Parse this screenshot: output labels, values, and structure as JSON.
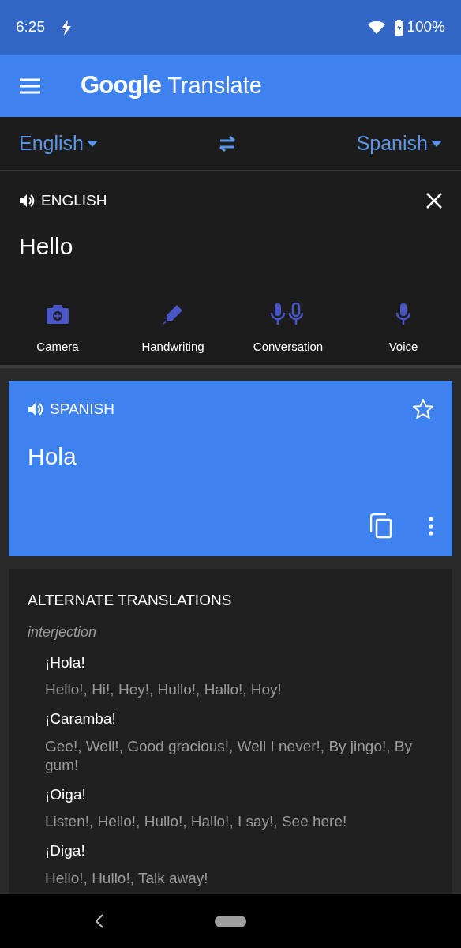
{
  "status_bar": {
    "time": "6:25",
    "battery": "100%"
  },
  "app_bar": {
    "title_brand": "Google",
    "title_product": "Translate"
  },
  "languages": {
    "source": "English",
    "target": "Spanish"
  },
  "input": {
    "language_label": "ENGLISH",
    "text": "Hello"
  },
  "tools": [
    {
      "kind": "camera",
      "label": "Camera"
    },
    {
      "kind": "handwriting",
      "label": "Handwriting"
    },
    {
      "kind": "conversation",
      "label": "Conversation"
    },
    {
      "kind": "voice",
      "label": "Voice"
    }
  ],
  "result": {
    "language_label": "SPANISH",
    "text": "Hola",
    "starred": false
  },
  "alternates": {
    "heading": "ALTERNATE TRANSLATIONS",
    "part_of_speech": "interjection",
    "entries": [
      {
        "word": "¡Hola!",
        "meanings": "Hello!, Hi!, Hey!, Hullo!, Hallo!, Hoy!"
      },
      {
        "word": "¡Caramba!",
        "meanings": "Gee!, Well!, Good gracious!, Well I never!, By jingo!, By gum!"
      },
      {
        "word": "¡Oiga!",
        "meanings": "Listen!, Hello!, Hullo!, Hallo!, I say!, See here!"
      },
      {
        "word": "¡Diga!",
        "meanings": "Hello!, Hullo!, Talk away!"
      }
    ]
  }
}
